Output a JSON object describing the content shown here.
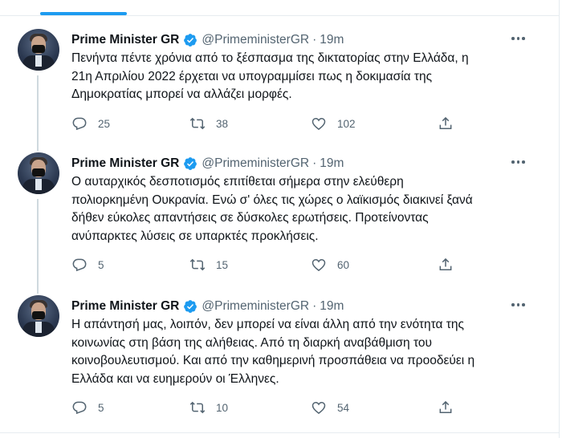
{
  "account": {
    "name": "Prime Minister GR",
    "handle": "@PrimeministerGR",
    "separator": "·"
  },
  "tweets": [
    {
      "time": "19m",
      "text_lines": [
        "Πενήντα πέντε χρόνια από το ξέσπασμα της δικτατορίας στην Ελλάδα, η",
        "21η Απριλίου 2022 έρχεται να υπογραμμίσει πως η δοκιμασία της",
        "Δημοκρατίας μπορεί να αλλάζει μορφές."
      ],
      "replies": "25",
      "retweets": "38",
      "likes": "102"
    },
    {
      "time": "19m",
      "text_lines": [
        "Ο αυταρχικός δεσποτισμός επιτίθεται σήμερα στην ελεύθερη",
        "πολιορκημένη Ουκρανία. Ενώ σ' όλες τις χώρες ο λαϊκισμός διακινεί ξανά",
        "δήθεν εύκολες απαντήσεις σε δύσκολες ερωτήσεις. Προτείνοντας",
        "ανύπαρκτες λύσεις σε υπαρκτές προκλήσεις."
      ],
      "replies": "5",
      "retweets": "15",
      "likes": "60"
    },
    {
      "time": "19m",
      "text_lines": [
        "Η απάντησή μας, λοιπόν, δεν μπορεί να είναι άλλη από την ενότητα της",
        "κοινωνίας στη βάση της αλήθειας. Από τη διαρκή αναβάθμιση του",
        "κοινοβουλευτισμού. Και από την καθημερινή προσπάθεια να προοδεύει η",
        "Ελλάδα και να ευημερούν οι Έλληνες."
      ],
      "replies": "5",
      "retweets": "10",
      "likes": "54"
    }
  ],
  "colors": {
    "accent": "#1d9bf0",
    "secondary_text": "#536471",
    "divider": "#e6ecf0",
    "thread_line": "#cfd9de"
  }
}
